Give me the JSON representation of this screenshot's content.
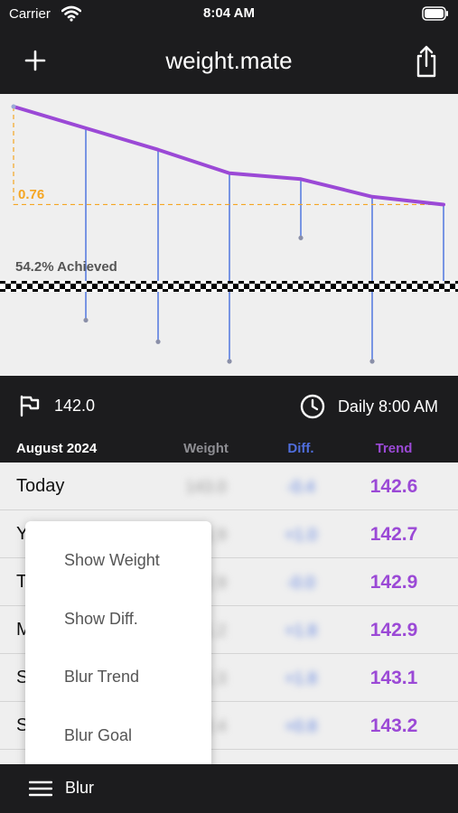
{
  "status_bar": {
    "carrier": "Carrier",
    "time": "8:04 AM"
  },
  "nav": {
    "title": "weight.mate",
    "left_icon": "plus-icon",
    "right_icon": "share-icon"
  },
  "chart": {
    "goal_value_label": "0.76",
    "achieved_label": "54.2% Achieved",
    "colors": {
      "trend_line": "#9b49d6",
      "diff_stems": "#5a7ee0",
      "goal_guide": "#f5a623",
      "background": "#efefef"
    }
  },
  "chart_data": {
    "type": "line",
    "series": [
      {
        "values": [
          0.0,
          0.11,
          0.22,
          0.34,
          0.37,
          0.46,
          0.5
        ]
      }
    ],
    "stems": [
      0.0,
      1.09,
      1.2,
      1.3,
      0.67,
      1.3,
      0.92
    ],
    "goal_line_value": 0.92,
    "grid": false
  },
  "info": {
    "goal_value": "142.0",
    "goal_icon": "flag-icon",
    "reminder_label": "Daily 8:00 AM",
    "reminder_icon": "clock-icon"
  },
  "table": {
    "month": "August 2024",
    "columns": [
      "Weight",
      "Diff.",
      "Trend"
    ],
    "rows": [
      {
        "label": "Today",
        "weight": "143.0",
        "diff": "-0.4",
        "trend": "142.6"
      },
      {
        "label": "Y",
        "weight": "141.9",
        "diff": "+1.0",
        "trend": "142.7"
      },
      {
        "label": "T",
        "weight": "142.9",
        "diff": "-0.0",
        "trend": "142.9"
      },
      {
        "label": "M",
        "weight": "141.2",
        "diff": "+1.8",
        "trend": "142.9"
      },
      {
        "label": "S",
        "weight": "141.3",
        "diff": "+1.8",
        "trend": "143.1"
      },
      {
        "label": "S",
        "weight": "142.4",
        "diff": "+0.8",
        "trend": "143.2"
      }
    ]
  },
  "menu": {
    "items": [
      "Show Weight",
      "Show Diff.",
      "Blur Trend",
      "Blur Goal"
    ]
  },
  "toolbar": {
    "blur_label": "Blur",
    "blur_icon": "hamburger-icon"
  }
}
